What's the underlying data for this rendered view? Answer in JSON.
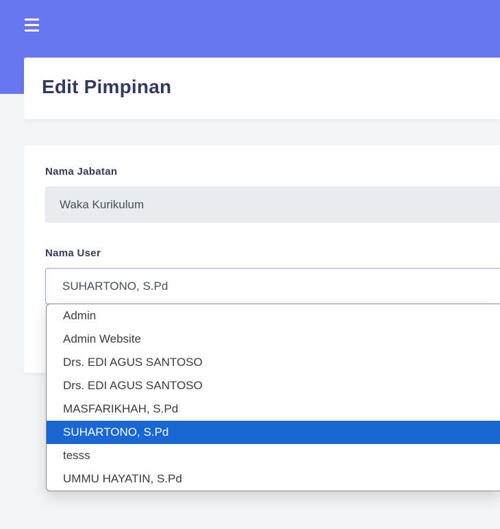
{
  "header": {
    "menu_icon": "hamburger-menu-icon",
    "title": "Edit Pimpinan"
  },
  "form": {
    "jabatan_label": "Nama Jabatan",
    "jabatan_value": "Waka Kurikulum",
    "user_label": "Nama User",
    "user_selected": "SUHARTONO, S.Pd",
    "options": [
      {
        "label": "Admin",
        "selected": false
      },
      {
        "label": "Admin Website",
        "selected": false
      },
      {
        "label": "Drs. EDI AGUS SANTOSO",
        "selected": false
      },
      {
        "label": "Drs. EDI AGUS SANTOSO",
        "selected": false
      },
      {
        "label": "MASFARIKHAH, S.Pd",
        "selected": false
      },
      {
        "label": "SUHARTONO, S.Pd",
        "selected": true
      },
      {
        "label": "tesss",
        "selected": false
      },
      {
        "label": "UMMU HAYATIN, S.Pd",
        "selected": false
      }
    ]
  },
  "colors": {
    "topbar": "#6777ef",
    "title": "#34395e",
    "selected_option_bg": "#1a66d2"
  }
}
